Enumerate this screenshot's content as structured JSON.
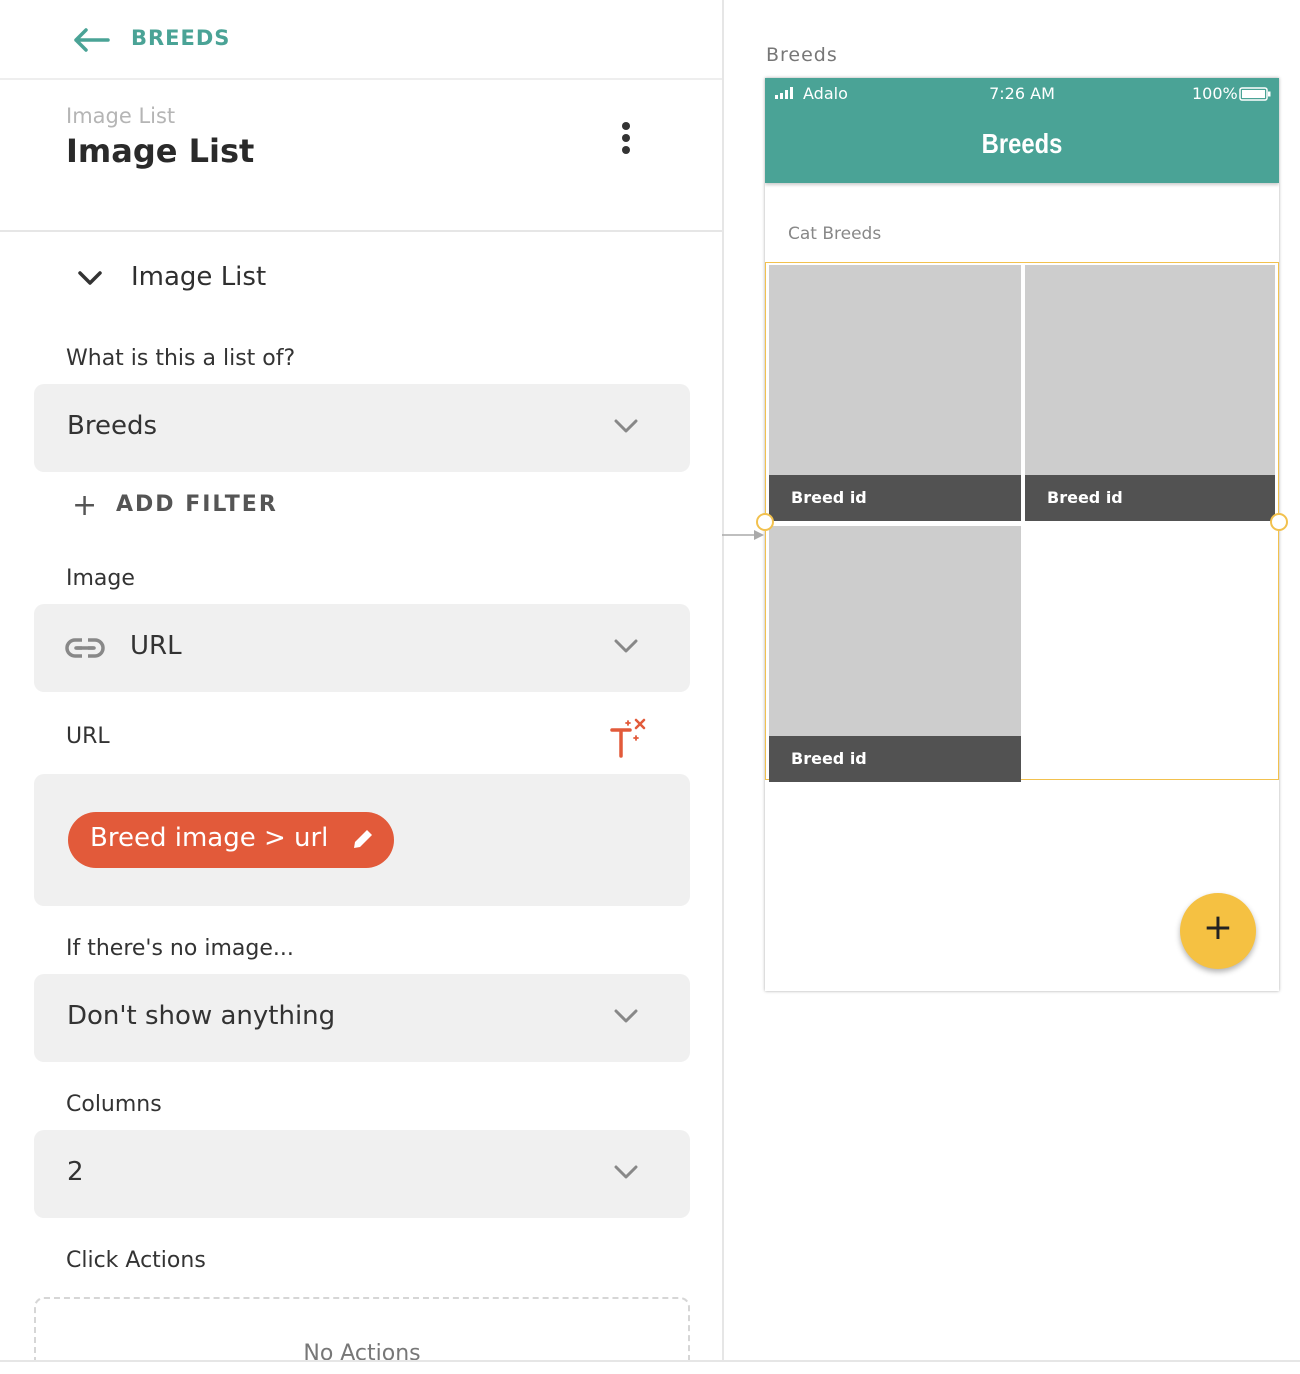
{
  "nav": {
    "back_label": "BREEDS"
  },
  "header": {
    "subtitle": "Image List",
    "title": "Image List"
  },
  "section": {
    "title": "Image List"
  },
  "list_of": {
    "label": "What is this a list of?",
    "value": "Breeds"
  },
  "add_filter": {
    "label": "ADD FILTER"
  },
  "image": {
    "label": "Image",
    "value": "URL"
  },
  "url": {
    "label": "URL",
    "chip": "Breed image > url"
  },
  "no_image": {
    "label": "If there's no image...",
    "value": "Don't show anything"
  },
  "columns": {
    "label": "Columns",
    "value": "2"
  },
  "click_actions": {
    "label": "Click Actions",
    "empty_text": "No Actions"
  },
  "canvas": {
    "screen_name": "Breeds",
    "status": {
      "carrier": "Adalo",
      "time": "7:26 AM",
      "battery": "100%"
    },
    "appbar_title": "Breeds",
    "list_heading": "Cat Breeds",
    "tiles": [
      {
        "caption": "Breed id"
      },
      {
        "caption": "Breed id"
      },
      {
        "caption": "Breed id"
      }
    ],
    "fab_symbol": "+"
  },
  "colors": {
    "accent": "#4aa396",
    "chip": "#e25a3a",
    "selection": "#f2c14e",
    "fab": "#f5c142"
  },
  "icons": [
    "back-arrow-icon",
    "more-vert-icon",
    "chevron-down-icon",
    "plus-icon",
    "link-icon",
    "magic-text-icon",
    "pencil-icon",
    "signal-icon",
    "battery-icon"
  ]
}
